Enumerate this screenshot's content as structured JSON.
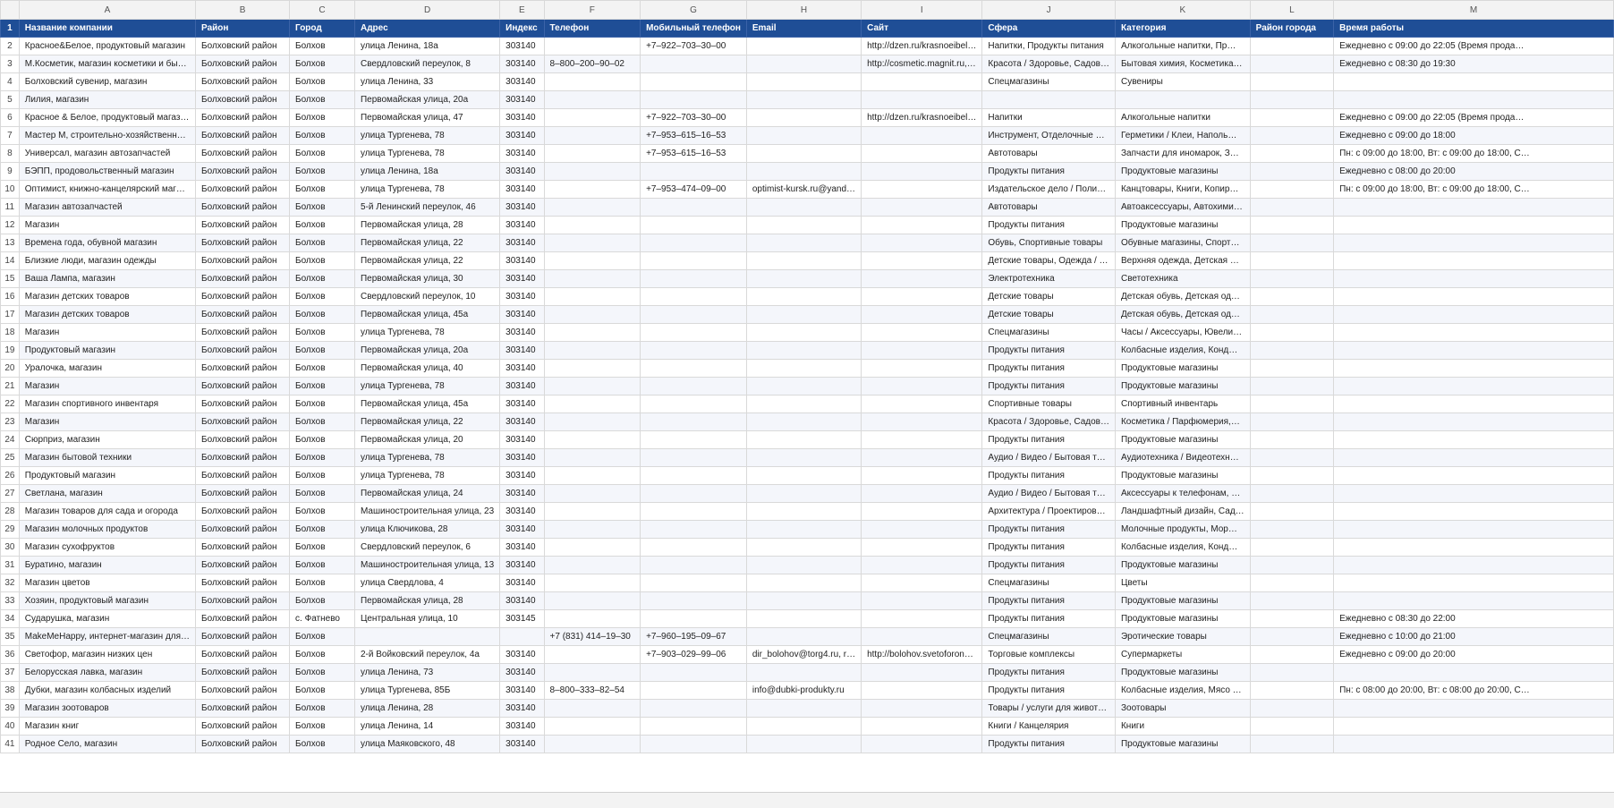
{
  "columns": [
    "A",
    "B",
    "C",
    "D",
    "E",
    "F",
    "G",
    "H",
    "I",
    "J",
    "K",
    "L",
    "M"
  ],
  "headers": [
    "Название компании",
    "Район",
    "Город",
    "Адрес",
    "Индекс",
    "Телефон",
    "Мобильный телефон",
    "Email",
    "Сайт",
    "Сфера",
    "Категория",
    "Район города",
    "Время работы"
  ],
  "rows": [
    [
      "2",
      "Красное&Белое, продуктовый магазин",
      "Болховский район",
      "Болхов",
      "улица Ленина, 18а",
      "303140",
      "",
      "+7‒922‒703‒30‒00",
      "",
      "http://dzen.ru/krasnoeibel…",
      "Напитки, Продукты питания",
      "Алкогольные напитки, Пр…",
      "",
      "Ежедневно с 09:00 до 22:05 (Время прода…"
    ],
    [
      "3",
      "М.Косметик, магазин косметики и бы…",
      "Болховский район",
      "Болхов",
      "Свердловский переулок, 8",
      "303140",
      "8‒800‒200‒90‒02",
      "",
      "",
      "http://cosmetic.magnit.ru,…",
      "Красота / Здоровье, Садов…",
      "Бытовая химия, Косметика…",
      "",
      "Ежедневно с 08:30 до 19:30"
    ],
    [
      "4",
      "Болховский сувенир, магазин",
      "Болховский район",
      "Болхов",
      "улица Ленина, 33",
      "303140",
      "",
      "",
      "",
      "",
      "Спецмагазины",
      "Сувениры",
      "",
      ""
    ],
    [
      "5",
      "Лилия, магазин",
      "Болховский район",
      "Болхов",
      "Первомайская улица, 20а",
      "303140",
      "",
      "",
      "",
      "",
      "",
      "",
      "",
      ""
    ],
    [
      "6",
      "Красное & Белое, продуктовый магаз…",
      "Болховский район",
      "Болхов",
      "Первомайская улица, 47",
      "303140",
      "",
      "+7‒922‒703‒30‒00",
      "",
      "http://dzen.ru/krasnoeibel…",
      "Напитки",
      "Алкогольные напитки",
      "",
      "Ежедневно с 09:00 до 22:05 (Время прода…"
    ],
    [
      "7",
      "Мастер М, строительно-хозяйственн…",
      "Болховский район",
      "Болхов",
      "улица Тургенева, 78",
      "303140",
      "",
      "+7‒953‒615‒16‒53",
      "",
      "",
      "Инструмент, Отделочные …",
      "Герметики / Клеи, Наполь…",
      "",
      "Ежедневно с 09:00 до 18:00"
    ],
    [
      "8",
      "Универсал, магазин автозапчастей",
      "Болховский район",
      "Болхов",
      "улица Тургенева, 78",
      "303140",
      "",
      "+7‒953‒615‒16‒53",
      "",
      "",
      "Автотовары",
      "Запчасти для иномарок, З…",
      "",
      "Пн: с 09:00 до 18:00, Вт: с 09:00 до 18:00, С…"
    ],
    [
      "9",
      "БЭПП, продовольственный магазин",
      "Болховский район",
      "Болхов",
      "улица Ленина, 18а",
      "303140",
      "",
      "",
      "",
      "",
      "Продукты питания",
      "Продуктовые магазины",
      "",
      "Ежедневно с 08:00 до 20:00"
    ],
    [
      "10",
      "Оптимист, книжно-канцелярский маг…",
      "Болховский район",
      "Болхов",
      "улица Тургенева, 78",
      "303140",
      "",
      "+7‒953‒474‒09‒00",
      "optimist-kursk.ru@yand…",
      "",
      "Издательское дело / Поли…",
      "Канцтовары, Книги, Копир…",
      "",
      "Пн: с 09:00 до 18:00, Вт: с 09:00 до 18:00, С…"
    ],
    [
      "11",
      "Магазин автозапчастей",
      "Болховский район",
      "Болхов",
      "5-й Ленинский переулок, 46",
      "303140",
      "",
      "",
      "",
      "",
      "Автотовары",
      "Автоаксессуары, Автохими…",
      "",
      ""
    ],
    [
      "12",
      "Магазин",
      "Болховский район",
      "Болхов",
      "Первомайская улица, 28",
      "303140",
      "",
      "",
      "",
      "",
      "Продукты питания",
      "Продуктовые магазины",
      "",
      ""
    ],
    [
      "13",
      "Времена года, обувной магазин",
      "Болховский район",
      "Болхов",
      "Первомайская улица, 22",
      "303140",
      "",
      "",
      "",
      "",
      "Обувь, Спортивные товары",
      "Обувные магазины, Спорт…",
      "",
      ""
    ],
    [
      "14",
      "Близкие люди, магазин одежды",
      "Болховский район",
      "Болхов",
      "Первомайская улица, 22",
      "303140",
      "",
      "",
      "",
      "",
      "Детские товары, Одежда / …",
      "Верхняя одежда, Детская …",
      "",
      ""
    ],
    [
      "15",
      "Ваша Лампа, магазин",
      "Болховский район",
      "Болхов",
      "Первомайская улица, 30",
      "303140",
      "",
      "",
      "",
      "",
      "Электротехника",
      "Светотехника",
      "",
      ""
    ],
    [
      "16",
      "Магазин детских товаров",
      "Болховский район",
      "Болхов",
      "Свердловский переулок, 10",
      "303140",
      "",
      "",
      "",
      "",
      "Детские товары",
      "Детская обувь, Детская од…",
      "",
      ""
    ],
    [
      "17",
      "Магазин детских товаров",
      "Болховский район",
      "Болхов",
      "Первомайская улица, 45а",
      "303140",
      "",
      "",
      "",
      "",
      "Детские товары",
      "Детская обувь, Детская од…",
      "",
      ""
    ],
    [
      "18",
      "Магазин",
      "Болховский район",
      "Болхов",
      "улица Тургенева, 78",
      "303140",
      "",
      "",
      "",
      "",
      "Спецмагазины",
      "Часы / Аксессуары, Ювели…",
      "",
      ""
    ],
    [
      "19",
      "Продуктовый магазин",
      "Болховский район",
      "Болхов",
      "Первомайская улица, 20а",
      "303140",
      "",
      "",
      "",
      "",
      "Продукты питания",
      "Колбасные изделия, Конд…",
      "",
      ""
    ],
    [
      "20",
      "Уралочка, магазин",
      "Болховский район",
      "Болхов",
      "Первомайская улица, 40",
      "303140",
      "",
      "",
      "",
      "",
      "Продукты питания",
      "Продуктовые магазины",
      "",
      ""
    ],
    [
      "21",
      "Магазин",
      "Болховский район",
      "Болхов",
      "улица Тургенева, 78",
      "303140",
      "",
      "",
      "",
      "",
      "Продукты питания",
      "Продуктовые магазины",
      "",
      ""
    ],
    [
      "22",
      "Магазин спортивного инвентаря",
      "Болховский район",
      "Болхов",
      "Первомайская улица, 45а",
      "303140",
      "",
      "",
      "",
      "",
      "Спортивные товары",
      "Спортивный инвентарь",
      "",
      ""
    ],
    [
      "23",
      "Магазин",
      "Болховский район",
      "Болхов",
      "Первомайская улица, 22",
      "303140",
      "",
      "",
      "",
      "",
      "Красота / Здоровье, Садов…",
      "Косметика / Парфюмерия,…",
      "",
      ""
    ],
    [
      "24",
      "Сюрприз, магазин",
      "Болховский район",
      "Болхов",
      "Первомайская улица, 20",
      "303140",
      "",
      "",
      "",
      "",
      "Продукты питания",
      "Продуктовые магазины",
      "",
      ""
    ],
    [
      "25",
      "Магазин бытовой техники",
      "Болховский район",
      "Болхов",
      "улица Тургенева, 78",
      "303140",
      "",
      "",
      "",
      "",
      "Аудио / Видео / Бытовая т…",
      "Аудиотехника / Видеотехн…",
      "",
      ""
    ],
    [
      "26",
      "Продуктовый магазин",
      "Болховский район",
      "Болхов",
      "улица Тургенева, 78",
      "303140",
      "",
      "",
      "",
      "",
      "Продукты питания",
      "Продуктовые магазины",
      "",
      ""
    ],
    [
      "27",
      "Светлана, магазин",
      "Болховский район",
      "Болхов",
      "Первомайская улица, 24",
      "303140",
      "",
      "",
      "",
      "",
      "Аудио / Видео / Бытовая т…",
      "Аксессуары к телефонам, …",
      "",
      ""
    ],
    [
      "28",
      "Магазин товаров для сада и огорода",
      "Болховский район",
      "Болхов",
      "Машиностроительная улица, 23",
      "303140",
      "",
      "",
      "",
      "",
      "Архитектура / Проектиров…",
      "Ландшафтный дизайн, Сад…",
      "",
      ""
    ],
    [
      "29",
      "Магазин молочных продуктов",
      "Болховский район",
      "Болхов",
      "улица Ключикова, 28",
      "303140",
      "",
      "",
      "",
      "",
      "Продукты питания",
      "Молочные продукты, Мор…",
      "",
      ""
    ],
    [
      "30",
      "Магазин сухофруктов",
      "Болховский район",
      "Болхов",
      "Свердловский переулок, 6",
      "303140",
      "",
      "",
      "",
      "",
      "Продукты питания",
      "Колбасные изделия, Конд…",
      "",
      ""
    ],
    [
      "31",
      "Буратино, магазин",
      "Болховский район",
      "Болхов",
      "Машиностроительная улица, 13",
      "303140",
      "",
      "",
      "",
      "",
      "Продукты питания",
      "Продуктовые магазины",
      "",
      ""
    ],
    [
      "32",
      "Магазин цветов",
      "Болховский район",
      "Болхов",
      "улица Свердлова, 4",
      "303140",
      "",
      "",
      "",
      "",
      "Спецмагазины",
      "Цветы",
      "",
      ""
    ],
    [
      "33",
      "Хозяин, продуктовый магазин",
      "Болховский район",
      "Болхов",
      "Первомайская улица, 28",
      "303140",
      "",
      "",
      "",
      "",
      "Продукты питания",
      "Продуктовые магазины",
      "",
      ""
    ],
    [
      "34",
      "Сударушка, магазин",
      "Болховский район",
      "с. Фатнево",
      "Центральная улица, 10",
      "303145",
      "",
      "",
      "",
      "",
      "Продукты питания",
      "Продуктовые магазины",
      "",
      "Ежедневно с 08:30 до 22:00"
    ],
    [
      "35",
      "MakeMeHappy, интернет-магазин для…",
      "Болховский район",
      "Болхов",
      "",
      "",
      "+7 (831) 414‒19‒30",
      "+7‒960‒195‒09‒67",
      "",
      "",
      "Спецмагазины",
      "Эротические товары",
      "",
      "Ежедневно с 10:00 до 21:00"
    ],
    [
      "36",
      "Светофор, магазин низких цен",
      "Болховский район",
      "Болхов",
      "2-й Войковский переулок, 4а",
      "303140",
      "",
      "+7‒903‒029‒99‒06",
      "dir_bolohov@torg4.ru, r…",
      "http://bolohov.svetoforon…",
      "Торговые комплексы",
      "Супермаркеты",
      "",
      "Ежедневно с 09:00 до 20:00"
    ],
    [
      "37",
      "Белорусская лавка, магазин",
      "Болховский район",
      "Болхов",
      "улица Ленина, 73",
      "303140",
      "",
      "",
      "",
      "",
      "Продукты питания",
      "Продуктовые магазины",
      "",
      ""
    ],
    [
      "38",
      "Дубки, магазин колбасных изделий",
      "Болховский район",
      "Болхов",
      "улица Тургенева, 85Б",
      "303140",
      "8‒800‒333‒82‒54",
      "",
      "info@dubki-produkty.ru",
      "",
      "Продукты питания",
      "Колбасные изделия, Мясо …",
      "",
      "Пн: с 08:00 до 20:00, Вт: с 08:00 до 20:00, С…"
    ],
    [
      "39",
      "Магазин зоотоваров",
      "Болховский район",
      "Болхов",
      "улица Ленина, 28",
      "303140",
      "",
      "",
      "",
      "",
      "Товары / услуги для живот…",
      "Зоотовары",
      "",
      ""
    ],
    [
      "40",
      "Магазин книг",
      "Болховский район",
      "Болхов",
      "улица Ленина, 14",
      "303140",
      "",
      "",
      "",
      "",
      "Книги / Канцелярия",
      "Книги",
      "",
      ""
    ],
    [
      "41",
      "Родное Село, магазин",
      "Болховский район",
      "Болхов",
      "улица Маяковского, 48",
      "303140",
      "",
      "",
      "",
      "",
      "Продукты питания",
      "Продуктовые магазины",
      "",
      ""
    ]
  ],
  "colors": {
    "header_bg": "#1f4e96",
    "header_text": "#ffffff",
    "stripe": "#f4f6fb",
    "grid": "#d9d9d9"
  }
}
